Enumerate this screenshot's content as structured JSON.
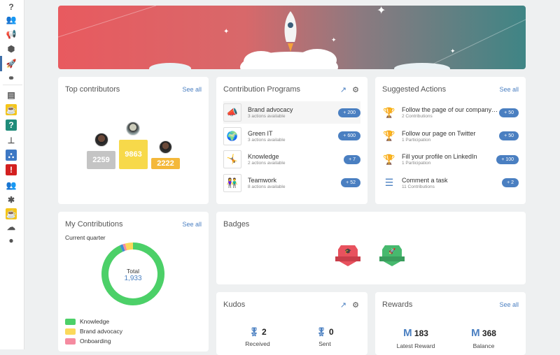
{
  "sidebar": {
    "items": [
      {
        "icon": "help-icon",
        "glyph": "?"
      },
      {
        "icon": "community-icon",
        "glyph": "👥"
      },
      {
        "icon": "megaphone-icon",
        "glyph": "📢"
      },
      {
        "icon": "box-icon",
        "glyph": "⬢"
      },
      {
        "icon": "rocket-icon",
        "glyph": "🚀"
      },
      {
        "icon": "people-link-icon",
        "glyph": "⚭"
      },
      {
        "icon": "card-icon",
        "glyph": "▤"
      },
      {
        "icon": "coffee-app-icon",
        "glyph": "☕",
        "color": "#f5c518"
      },
      {
        "icon": "faq-app-icon",
        "glyph": "?",
        "color": "#1f8c7a"
      },
      {
        "icon": "org-chart-icon",
        "glyph": "⊥"
      },
      {
        "icon": "team-app-icon",
        "glyph": "⛬",
        "color": "#3d78c4"
      },
      {
        "icon": "alert-app-icon",
        "glyph": "!",
        "color": "#d32020"
      },
      {
        "icon": "users-icon",
        "glyph": "👥"
      },
      {
        "icon": "puzzle-app-icon",
        "glyph": "✱"
      },
      {
        "icon": "coffee-app-icon-2",
        "glyph": "☕",
        "color": "#f5c518"
      },
      {
        "icon": "cloud-app-icon",
        "glyph": "☁"
      },
      {
        "icon": "user-avatar-icon",
        "glyph": "●"
      }
    ]
  },
  "top_contributors": {
    "title": "Top contributors",
    "see_all": "See all",
    "podium": [
      {
        "rank": 2,
        "score": "2259"
      },
      {
        "rank": 1,
        "score": "9863"
      },
      {
        "rank": 3,
        "score": "2222"
      }
    ]
  },
  "programs": {
    "title": "Contribution Programs",
    "items": [
      {
        "name": "Brand advocacy",
        "sub": "3 actions available",
        "points": "+ 200",
        "glyph": "📣"
      },
      {
        "name": "Green IT",
        "sub": "3 actions available",
        "points": "+ 600",
        "glyph": "🌍"
      },
      {
        "name": "Knowledge",
        "sub": "2 actions available",
        "points": "+ 7",
        "glyph": "🤸"
      },
      {
        "name": "Teamwork",
        "sub": "8 actions available",
        "points": "+ 52",
        "glyph": "👫"
      }
    ]
  },
  "suggested": {
    "title": "Suggested Actions",
    "see_all": "See all",
    "items": [
      {
        "name": "Follow the page of our company on LinkedIn",
        "sub": "2 Contributions",
        "points": "+ 50",
        "icon": "trophy-icon"
      },
      {
        "name": "Follow our page on Twitter",
        "sub": "1 Participation",
        "points": "+ 50",
        "icon": "trophy-icon"
      },
      {
        "name": "Fill your profile on LinkedIn",
        "sub": "1 Participation",
        "points": "+ 100",
        "icon": "trophy-icon"
      },
      {
        "name": "Comment a task",
        "sub": "11 Contributions",
        "points": "+ 2",
        "icon": "checklist-icon"
      }
    ]
  },
  "my_contributions": {
    "title": "My Contributions",
    "see_all": "See all",
    "period": "Current quarter",
    "total_label": "Total",
    "total": "1,933"
  },
  "chart_data": {
    "type": "pie",
    "title": "My Contributions",
    "subtitle": "Current quarter",
    "total": 1933,
    "series": [
      {
        "name": "Knowledge",
        "value": 1800,
        "color": "#4cd068"
      },
      {
        "name": "Brand advocacy",
        "value": 78,
        "color": "#fbd95b"
      },
      {
        "name": "Onboarding",
        "value": 25,
        "color": "#f58ba0"
      },
      {
        "name": "",
        "value": 30,
        "color": "#3f8fd0"
      }
    ],
    "legend": "bottom"
  },
  "badges": {
    "title": "Badges",
    "items": [
      {
        "name": "KNOWLEDGE",
        "color": "#e8525e"
      },
      {
        "name": "ENGAGEMENT",
        "color": "#47b96e"
      }
    ]
  },
  "kudos": {
    "title": "Kudos",
    "received": "2",
    "received_label": "Received",
    "sent": "0",
    "sent_label": "Sent"
  },
  "rewards": {
    "title": "Rewards",
    "see_all": "See all",
    "latest": "183",
    "latest_label": "Latest Reward",
    "balance": "368",
    "balance_label": "Balance",
    "currency": "M"
  }
}
